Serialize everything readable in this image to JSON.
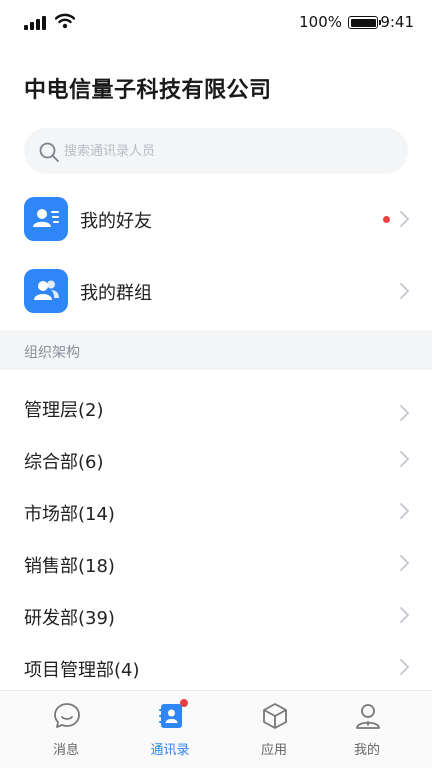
{
  "status_bar": {
    "battery_percent": "100%",
    "time": "9:41"
  },
  "header": {
    "title": "中电信量子科技有限公司"
  },
  "search": {
    "placeholder": "搜索通讯录人员"
  },
  "quick_links": [
    {
      "label": "我的好友",
      "icon": "friend-card-icon",
      "has_badge": true
    },
    {
      "label": "我的群组",
      "icon": "group-icon",
      "has_badge": false
    }
  ],
  "org_section": {
    "title": "组织架构",
    "departments": [
      {
        "label": "管理层(2)"
      },
      {
        "label": "综合部(6)"
      },
      {
        "label": "市场部(14)"
      },
      {
        "label": "销售部(18)"
      },
      {
        "label": "研发部(39)"
      },
      {
        "label": "项目管理部(4)"
      }
    ]
  },
  "tab_bar": {
    "tabs": [
      {
        "label": "消息",
        "icon": "message-icon",
        "active": false
      },
      {
        "label": "通讯录",
        "icon": "contacts-icon",
        "active": true,
        "has_badge": true
      },
      {
        "label": "应用",
        "icon": "apps-box-icon",
        "active": false
      },
      {
        "label": "我的",
        "icon": "profile-icon",
        "active": false
      }
    ]
  },
  "colors": {
    "accent": "#2f86f6",
    "badge": "#e8413f",
    "section_bg": "#f4f5f7"
  }
}
